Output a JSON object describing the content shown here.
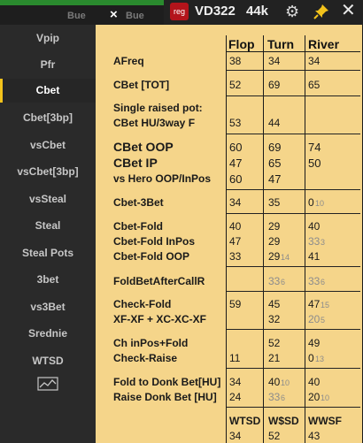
{
  "background_window": {
    "tab1": "Bue",
    "tab2": "Bue"
  },
  "header": {
    "badge": "reg",
    "player": "VD322",
    "hands": "44k",
    "accent_color": "#b3141b",
    "pin_color": "#f2c21b"
  },
  "sidebar": {
    "items": [
      {
        "label": "Vpip"
      },
      {
        "label": "Pfr"
      },
      {
        "label": "Cbet"
      },
      {
        "label": "Cbet[3bp]"
      },
      {
        "label": "vsCbet"
      },
      {
        "label": "vsCbet[3bp]"
      },
      {
        "label": "vsSteal"
      },
      {
        "label": "Steal"
      },
      {
        "label": "Steal Pots"
      },
      {
        "label": "3bet"
      },
      {
        "label": "vs3Bet"
      },
      {
        "label": "Srednie"
      },
      {
        "label": "WTSD"
      }
    ],
    "active": "Cbet",
    "chart_icon": "line-chart-icon"
  },
  "table": {
    "columns": [
      "Flop",
      "Turn",
      "River"
    ],
    "rows": {
      "afreq": {
        "label": "AFreq",
        "flop": "38",
        "turn": "34",
        "river": "34"
      },
      "cbet_tot": {
        "label": "CBet [TOT]",
        "flop": "52",
        "turn": "69",
        "river": "65"
      },
      "single_raised": {
        "label": "Single raised pot:"
      },
      "cbet_hu3": {
        "label": "CBet HU/3way F",
        "flop": "53",
        "turn": "44"
      },
      "cbet_oop": {
        "label": "CBet OOP",
        "flop": "60",
        "turn": "69",
        "river": "74"
      },
      "cbet_ip": {
        "label": "CBet IP",
        "flop": "47",
        "turn": "65",
        "river": "50"
      },
      "vs_hero": {
        "label": "vs Hero OOP/InPos",
        "flop": "60",
        "turn": "47"
      },
      "cbet_3bet": {
        "label": "Cbet-3Bet",
        "flop": "34",
        "turn": "35",
        "river_main": "0",
        "river_sub": "10"
      },
      "cbet_fold": {
        "label": "Cbet-Fold",
        "flop": "40",
        "turn": "29",
        "river": "40"
      },
      "cbet_fold_inpos": {
        "label": "Cbet-Fold InPos",
        "flop": "47",
        "turn": "29",
        "river_main": "33",
        "river_sub": "3"
      },
      "cbet_fold_oop": {
        "label": "Cbet-Fold OOP",
        "flop": "33",
        "turn_main": "29",
        "turn_sub": "14",
        "river": "41"
      },
      "foldbet": {
        "label": "FoldBetAfterCallR",
        "turn_main": "33",
        "turn_sub": "6",
        "river_main": "33",
        "river_sub": "6"
      },
      "check_fold": {
        "label": "Check-Fold",
        "flop": "59",
        "turn": "45",
        "river_main": "47",
        "river_sub": "15"
      },
      "xf_xc": {
        "label": "XF-XF + XC-XC-XF",
        "turn": "32",
        "river_main": "20",
        "river_sub": "5"
      },
      "ch_inpos_fold": {
        "label": "Ch inPos+Fold",
        "turn": "52",
        "river": "49"
      },
      "check_raise": {
        "label": "Check-Raise",
        "flop": "11",
        "turn": "21",
        "river_main": "0",
        "river_sub": "13"
      },
      "fold_donk": {
        "label": "Fold to Donk Bet[HU]",
        "flop": "34",
        "turn_main": "40",
        "turn_sub": "10",
        "river": "40"
      },
      "raise_donk": {
        "label": "Raise Donk Bet [HU]",
        "flop": "24",
        "turn_main": "33",
        "turn_sub": "6",
        "river_main": "20",
        "river_sub": "10"
      }
    },
    "footer": {
      "headers": [
        "WTSD",
        "W$SD",
        "WWSF"
      ],
      "values": [
        "34",
        "52",
        "43"
      ]
    }
  }
}
